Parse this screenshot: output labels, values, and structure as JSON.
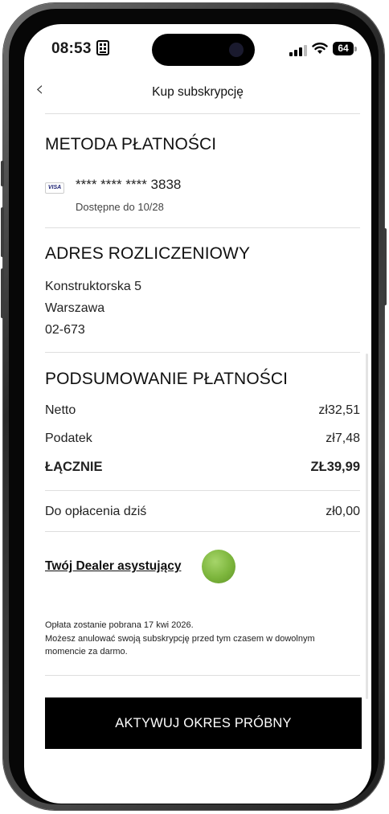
{
  "status": {
    "time": "08:53",
    "battery": "64"
  },
  "header": {
    "title": "Kup subskrypcję",
    "back_icon": "chevron-left-icon"
  },
  "payment_method": {
    "heading": "METODA PŁATNOŚCI",
    "card_brand": "VISA",
    "card_number": "**** **** **** 3838",
    "valid_until": "Dostępne do 10/28"
  },
  "billing_address": {
    "heading": "ADRES ROZLICZENIOWY",
    "street": "Konstruktorska 5",
    "city": "Warszawa",
    "postal_code": "02-673"
  },
  "summary": {
    "heading": "PODSUMOWANIE PŁATNOŚCI",
    "net_label": "Netto",
    "net_value": "zł32,51",
    "tax_label": "Podatek",
    "tax_value": "zł7,48",
    "total_label": "ŁĄCZNIE",
    "total_value": "ZŁ39,99",
    "due_today_label": "Do opłacenia dziś",
    "due_today_value": "zł0,00"
  },
  "dealer": {
    "link_label": "Twój Dealer asystujący",
    "indicator_color": "#7cb53c"
  },
  "notice": {
    "line1": "Opłata zostanie pobrana 17 kwi 2026.",
    "line2": "Możesz anulować swoją subskrypcję przed tym czasem w dowolnym momencie za darmo."
  },
  "cta": {
    "label": "AKTYWUJ OKRES PRÓBNY"
  },
  "colors": {
    "cta_background": "#000000",
    "divider": "#dedede"
  }
}
